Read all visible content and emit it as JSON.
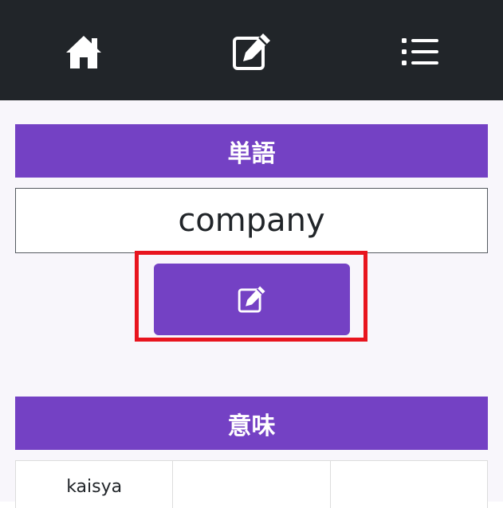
{
  "nav": {
    "items": [
      {
        "icon": "home-icon"
      },
      {
        "icon": "edit-icon"
      },
      {
        "icon": "list-icon"
      }
    ]
  },
  "word_section": {
    "header": "単語",
    "word": "company",
    "edit_icon": "edit-icon"
  },
  "meaning_section": {
    "header": "意味",
    "cells": [
      "kaisya",
      "",
      ""
    ]
  },
  "colors": {
    "nav_bg": "#212529",
    "accent": "#7441c4",
    "highlight": "#e8141e",
    "page_bg": "#f8f6fb"
  }
}
